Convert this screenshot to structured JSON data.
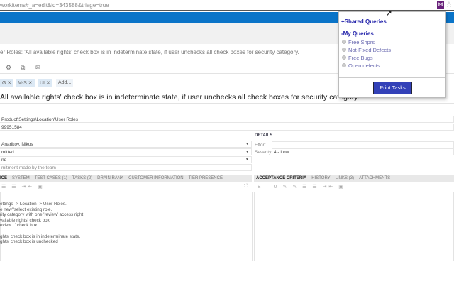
{
  "browser": {
    "url": "workitems#_a=edit&id=343588&triage=true"
  },
  "workitem": {
    "header_title": "er Roles: 'All available rights' check box is in indeterminate state, if user unchecks all check boxes for security category.",
    "tags": [
      "G",
      "M-S",
      "UI"
    ],
    "add_tag": "Add...",
    "title": "All available rights' check box is in indeterminate state, if user unchecks all check boxes for security category.",
    "area_path": "Product\\Settings\\Location\\User Roles",
    "iteration": "99951584",
    "assigned_to": "Anarikov, Nikos",
    "state": "mitted",
    "reason": "nd",
    "commitment_placeholder": "mitment made by the team",
    "details_heading": "DETAILS",
    "effort_label": "Effort",
    "effort_value": "",
    "severity_label": "Severity",
    "severity_value": "4 - Low",
    "left_tabs": [
      "ICE",
      "SYSTEM",
      "TEST CASES (1)",
      "TASKS (2)",
      "DRAIN RANK",
      "CUSTOMER INFORMATION",
      "TIER PRESENCE"
    ],
    "right_tabs": [
      "ACCEPTANCE CRITERIA",
      "HISTORY",
      "LINKS (3)",
      "ATTACHMENTS"
    ],
    "description_lines": [
      "ettings -> Location -> User Roles.",
      "e new'/select existing role.",
      "rity category with one 'review' access right",
      "vailable rights' check box.",
      "eview...' check box",
      "",
      "ghts' check box is in indeterminate state.",
      "ghts' check box is unchecked"
    ]
  },
  "popup": {
    "shared_queries": "+Shared Queries",
    "my_queries": "-My Queries",
    "queries": [
      "Free Shprs",
      "Not-Fixed Defects",
      "Free Bugs",
      "Open defects"
    ],
    "print_button": "Print Tasks"
  },
  "colors": {
    "blue_bar": "#0a74c8",
    "print_button": "#3341b8"
  }
}
